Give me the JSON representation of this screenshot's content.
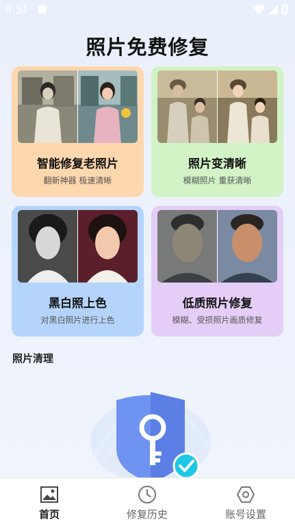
{
  "status": {
    "time": "9:51"
  },
  "title": "照片免费修复",
  "cards": [
    {
      "title": "智能修复老照片",
      "subtitle": "翻新神器 极速清晰"
    },
    {
      "title": "照片变清晰",
      "subtitle": "模糊照片 重获清晰"
    },
    {
      "title": "黑白照上色",
      "subtitle": "对黑白照片进行上色"
    },
    {
      "title": "低质照片修复",
      "subtitle": "模糊、受损照片画质修复"
    }
  ],
  "section": {
    "title": "照片清理"
  },
  "nav": {
    "home": "首页",
    "history": "修复历史",
    "account": "账号设置"
  },
  "colors": {
    "card1": "#fdd7ad",
    "card2": "#d2f3c6",
    "card3": "#b5d4fb",
    "card4": "#e4cdf6",
    "shield": "#6f93f0",
    "check": "#1fc7e6"
  }
}
